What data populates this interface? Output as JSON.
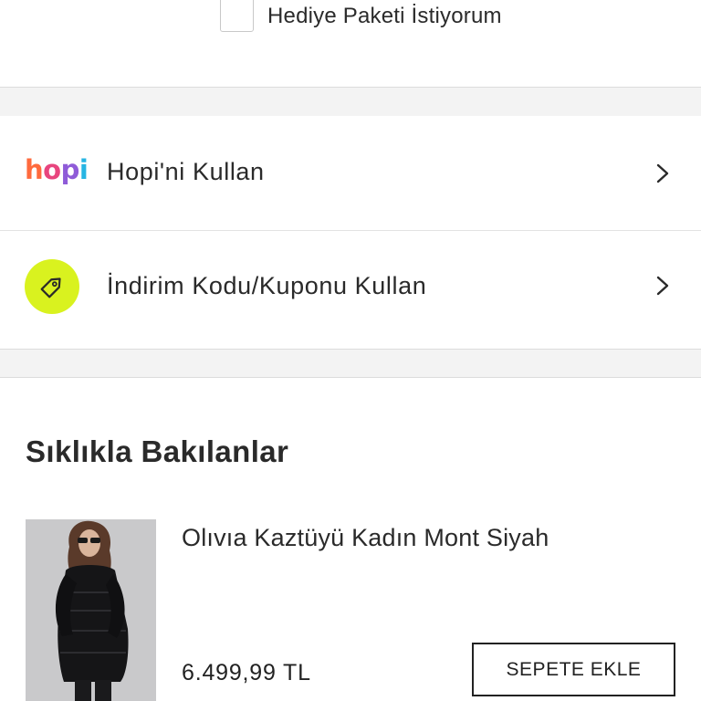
{
  "gift": {
    "label": "Hediye Paketi İstiyorum",
    "checked": false
  },
  "options": {
    "hopi": {
      "logo_text": {
        "h": "h",
        "o": "o",
        "p": "p",
        "i": "i"
      },
      "label": "Hopi'ni Kullan",
      "icon": "hopi-logo",
      "chevron": "chevron-right-icon"
    },
    "coupon": {
      "label": "İndirim Kodu/Kuponu Kullan",
      "icon": "tag-icon",
      "icon_bg": "#d9f21f",
      "chevron": "chevron-right-icon"
    }
  },
  "frequently_viewed": {
    "title": "Sıklıkla Bakılanlar",
    "products": [
      {
        "name": "Olıvıa Kaztüyü Kadın Mont Siyah",
        "price": "6.499,99 TL",
        "button_label": "SEPETE EKLE",
        "image": "woman-in-black-puffer-coat"
      }
    ]
  }
}
